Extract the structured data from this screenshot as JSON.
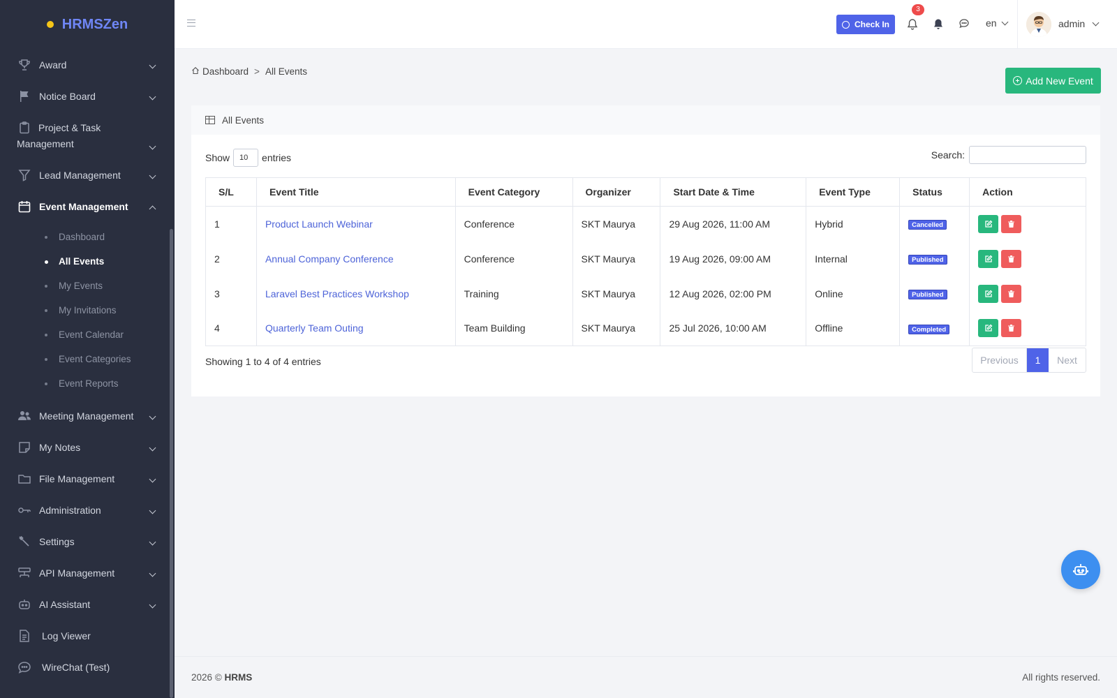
{
  "brand": {
    "name": "HRMSZen"
  },
  "sidebar": {
    "items": [
      {
        "label": "Award",
        "icon": "trophy-icon"
      },
      {
        "label": "Notice Board",
        "icon": "flag-icon"
      },
      {
        "label": "Project & Task",
        "label2": "Management",
        "icon": "clipboard-icon"
      },
      {
        "label": "Lead Management",
        "icon": "filter-icon"
      },
      {
        "label": "Event Management",
        "icon": "calendar-icon"
      },
      {
        "label": "Meeting Management",
        "icon": "users-icon"
      },
      {
        "label": "My Notes",
        "icon": "note-icon"
      },
      {
        "label": "File Management",
        "icon": "folder-icon"
      },
      {
        "label": "Administration",
        "icon": "key-icon"
      },
      {
        "label": "Settings",
        "icon": "wrench-icon"
      },
      {
        "label": "API Management",
        "icon": "network-icon"
      },
      {
        "label": "AI Assistant",
        "icon": "robot-icon"
      },
      {
        "label": "Log Viewer",
        "icon": "document-icon"
      },
      {
        "label": "WireChat (Test)",
        "icon": "chat-icon"
      }
    ],
    "event_sub": [
      {
        "label": "Dashboard"
      },
      {
        "label": "All Events"
      },
      {
        "label": "My Events"
      },
      {
        "label": "My Invitations"
      },
      {
        "label": "Event Calendar"
      },
      {
        "label": "Event Categories"
      },
      {
        "label": "Event Reports"
      }
    ]
  },
  "topbar": {
    "checkin_label": "Check In",
    "notification_count": "3",
    "language": "en",
    "user": "admin"
  },
  "breadcrumb": {
    "home": "Dashboard",
    "separator": ">",
    "current": "All Events"
  },
  "add_button": "Add New Event",
  "card": {
    "title": "All Events",
    "show_label": "Show",
    "entries_label": "entries",
    "page_length": "10",
    "search_label": "Search:",
    "search_value": ""
  },
  "table": {
    "headers": [
      "S/L",
      "Event Title",
      "Event Category",
      "Organizer",
      "Start Date & Time",
      "Event Type",
      "Status",
      "Action"
    ],
    "rows": [
      {
        "sl": "1",
        "title": "Product Launch Webinar",
        "category": "Conference",
        "organizer": "SKT Maurya",
        "start": "29 Aug 2026, 11:00 AM",
        "type": "Hybrid",
        "status": "Cancelled"
      },
      {
        "sl": "2",
        "title": "Annual Company Conference",
        "category": "Conference",
        "organizer": "SKT Maurya",
        "start": "19 Aug 2026, 09:00 AM",
        "type": "Internal",
        "status": "Published"
      },
      {
        "sl": "3",
        "title": "Laravel Best Practices Workshop",
        "category": "Training",
        "organizer": "SKT Maurya",
        "start": "12 Aug 2026, 02:00 PM",
        "type": "Online",
        "status": "Published"
      },
      {
        "sl": "4",
        "title": "Quarterly Team Outing",
        "category": "Team Building",
        "organizer": "SKT Maurya",
        "start": "25 Jul 2026, 10:00 AM",
        "type": "Offline",
        "status": "Completed"
      }
    ]
  },
  "pagination": {
    "info": "Showing 1 to 4 of 4 entries",
    "previous": "Previous",
    "current": "1",
    "next": "Next"
  },
  "footer": {
    "year": "2026 ©",
    "brand": "HRMS",
    "rights": "All rights reserved."
  },
  "colors": {
    "sidebar_bg": "#2a2f3f",
    "primary": "#4f63e8",
    "success": "#28b77d",
    "danger": "#ef5c5c",
    "link": "#4d63d8"
  }
}
